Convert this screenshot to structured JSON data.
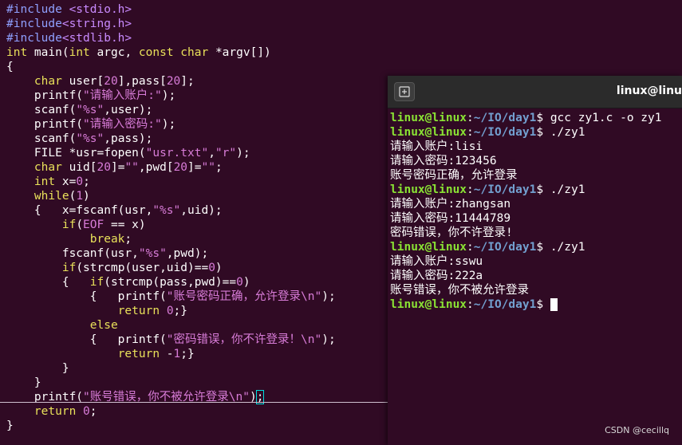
{
  "editor": {
    "lines": [
      [
        [
          "pre",
          "#include"
        ],
        [
          "inc",
          " <stdio.h>"
        ]
      ],
      [
        [
          "pre",
          "#include"
        ],
        [
          "inc",
          "<string.h>"
        ]
      ],
      [
        [
          "pre",
          "#include"
        ],
        [
          "inc",
          "<stdlib.h>"
        ]
      ],
      [
        [
          "kw",
          "int"
        ],
        [
          "plain",
          " main("
        ],
        [
          "kw",
          "int"
        ],
        [
          "plain",
          " argc, "
        ],
        [
          "kw",
          "const"
        ],
        [
          "plain",
          " "
        ],
        [
          "kw",
          "char"
        ],
        [
          "plain",
          " *argv[])"
        ]
      ],
      [
        [
          "plain",
          "{"
        ]
      ],
      [
        [
          "plain",
          "    "
        ],
        [
          "kw",
          "char"
        ],
        [
          "plain",
          " user["
        ],
        [
          "str",
          "20"
        ],
        [
          "plain",
          "],pass["
        ],
        [
          "str",
          "20"
        ],
        [
          "plain",
          "];"
        ]
      ],
      [
        [
          "plain",
          "    printf("
        ],
        [
          "str",
          "\"请输入账户:\""
        ],
        [
          "plain",
          ");"
        ]
      ],
      [
        [
          "plain",
          "    scanf("
        ],
        [
          "str",
          "\"%s\""
        ],
        [
          "plain",
          ",user);"
        ]
      ],
      [
        [
          "plain",
          "    printf("
        ],
        [
          "str",
          "\"请输入密码:\""
        ],
        [
          "plain",
          ");"
        ]
      ],
      [
        [
          "plain",
          "    scanf("
        ],
        [
          "str",
          "\"%s\""
        ],
        [
          "plain",
          ",pass);"
        ]
      ],
      [
        [
          "plain",
          "    FILE *usr=fopen("
        ],
        [
          "str",
          "\"usr.txt\""
        ],
        [
          "plain",
          ","
        ],
        [
          "str",
          "\"r\""
        ],
        [
          "plain",
          ");"
        ]
      ],
      [
        [
          "plain",
          "    "
        ],
        [
          "kw",
          "char"
        ],
        [
          "plain",
          " uid["
        ],
        [
          "str",
          "20"
        ],
        [
          "plain",
          "]="
        ],
        [
          "str",
          "\"\""
        ],
        [
          "plain",
          ",pwd["
        ],
        [
          "str",
          "20"
        ],
        [
          "plain",
          "]="
        ],
        [
          "str",
          "\"\""
        ],
        [
          "plain",
          ";"
        ]
      ],
      [
        [
          "plain",
          "    "
        ],
        [
          "kw",
          "int"
        ],
        [
          "plain",
          " x="
        ],
        [
          "str",
          "0"
        ],
        [
          "plain",
          ";"
        ]
      ],
      [
        [
          "plain",
          "    "
        ],
        [
          "kw",
          "while"
        ],
        [
          "plain",
          "("
        ],
        [
          "str",
          "1"
        ],
        [
          "plain",
          ")"
        ]
      ],
      [
        [
          "plain",
          "    {   x=fscanf(usr,"
        ],
        [
          "str",
          "\"%s\""
        ],
        [
          "plain",
          ",uid);"
        ]
      ],
      [
        [
          "plain",
          "        "
        ],
        [
          "kw",
          "if"
        ],
        [
          "plain",
          "("
        ],
        [
          "str",
          "EOF"
        ],
        [
          "plain",
          " == x)"
        ]
      ],
      [
        [
          "plain",
          "            "
        ],
        [
          "kw",
          "break"
        ],
        [
          "plain",
          ";"
        ]
      ],
      [
        [
          "plain",
          "        fscanf(usr,"
        ],
        [
          "str",
          "\"%s\""
        ],
        [
          "plain",
          ",pwd);"
        ]
      ],
      [
        [
          "plain",
          "        "
        ],
        [
          "kw",
          "if"
        ],
        [
          "plain",
          "(strcmp(user,uid)=="
        ],
        [
          "str",
          "0"
        ],
        [
          "plain",
          ")"
        ]
      ],
      [
        [
          "plain",
          "        {   "
        ],
        [
          "kw",
          "if"
        ],
        [
          "plain",
          "(strcmp(pass,pwd)=="
        ],
        [
          "str",
          "0"
        ],
        [
          "plain",
          ")"
        ]
      ],
      [
        [
          "plain",
          "            {   printf("
        ],
        [
          "str",
          "\"账号密码正确，允许登录\\n\""
        ],
        [
          "plain",
          ");"
        ]
      ],
      [
        [
          "plain",
          "                "
        ],
        [
          "kw",
          "return"
        ],
        [
          "plain",
          " "
        ],
        [
          "str",
          "0"
        ],
        [
          "plain",
          ";}"
        ]
      ],
      [
        [
          "plain",
          "            "
        ],
        [
          "kw",
          "else"
        ]
      ],
      [
        [
          "plain",
          "            {   printf("
        ],
        [
          "str",
          "\"密码错误，你不许登录！\\n\""
        ],
        [
          "plain",
          ");"
        ]
      ],
      [
        [
          "plain",
          "                "
        ],
        [
          "kw",
          "return"
        ],
        [
          "plain",
          " -"
        ],
        [
          "str",
          "1"
        ],
        [
          "plain",
          ";}"
        ]
      ],
      [
        [
          "plain",
          "        }"
        ]
      ],
      [
        [
          "plain",
          "    }"
        ]
      ],
      [
        [
          "plain",
          "    printf("
        ],
        [
          "str",
          "\"账号错误，你不被允许登录\\n\""
        ],
        [
          "plain",
          ")"
        ],
        [
          "cursor",
          ";"
        ]
      ],
      [
        [
          "plain",
          "    "
        ],
        [
          "kw",
          "return"
        ],
        [
          "plain",
          " "
        ],
        [
          "str",
          "0"
        ],
        [
          "plain",
          ";"
        ]
      ],
      [
        [
          "plain",
          "}"
        ]
      ]
    ]
  },
  "terminal": {
    "title": "linux@linu",
    "new_tab_icon": "new-tab-icon",
    "prompt": {
      "user": "linux@linux",
      "sep": ":",
      "path": "~/IO/day1",
      "symbol": "$ "
    },
    "lines": [
      {
        "kind": "prompt",
        "cmd": "gcc zy1.c -o zy1"
      },
      {
        "kind": "prompt",
        "cmd": "./zy1"
      },
      {
        "kind": "out",
        "text": "请输入账户:lisi"
      },
      {
        "kind": "out",
        "text": "请输入密码:123456"
      },
      {
        "kind": "out",
        "text": "账号密码正确，允许登录"
      },
      {
        "kind": "prompt",
        "cmd": "./zy1"
      },
      {
        "kind": "out",
        "text": "请输入账户:zhangsan"
      },
      {
        "kind": "out",
        "text": "请输入密码:11444789"
      },
      {
        "kind": "out",
        "text": "密码错误，你不许登录!"
      },
      {
        "kind": "prompt",
        "cmd": "./zy1"
      },
      {
        "kind": "out",
        "text": "请输入账户:sswu"
      },
      {
        "kind": "out",
        "text": "请输入密码:222a"
      },
      {
        "kind": "out",
        "text": "账号错误，你不被允许登录"
      },
      {
        "kind": "prompt",
        "cmd": "",
        "cursor": true
      }
    ]
  },
  "watermark": "CSDN @cecillq",
  "colors": {
    "background": "#300a24",
    "keyword": "#e9e15a",
    "string": "#d87cd8",
    "preprocessor": "#8fa0ff",
    "prompt_user": "#8ae234",
    "prompt_path": "#729fcf"
  }
}
